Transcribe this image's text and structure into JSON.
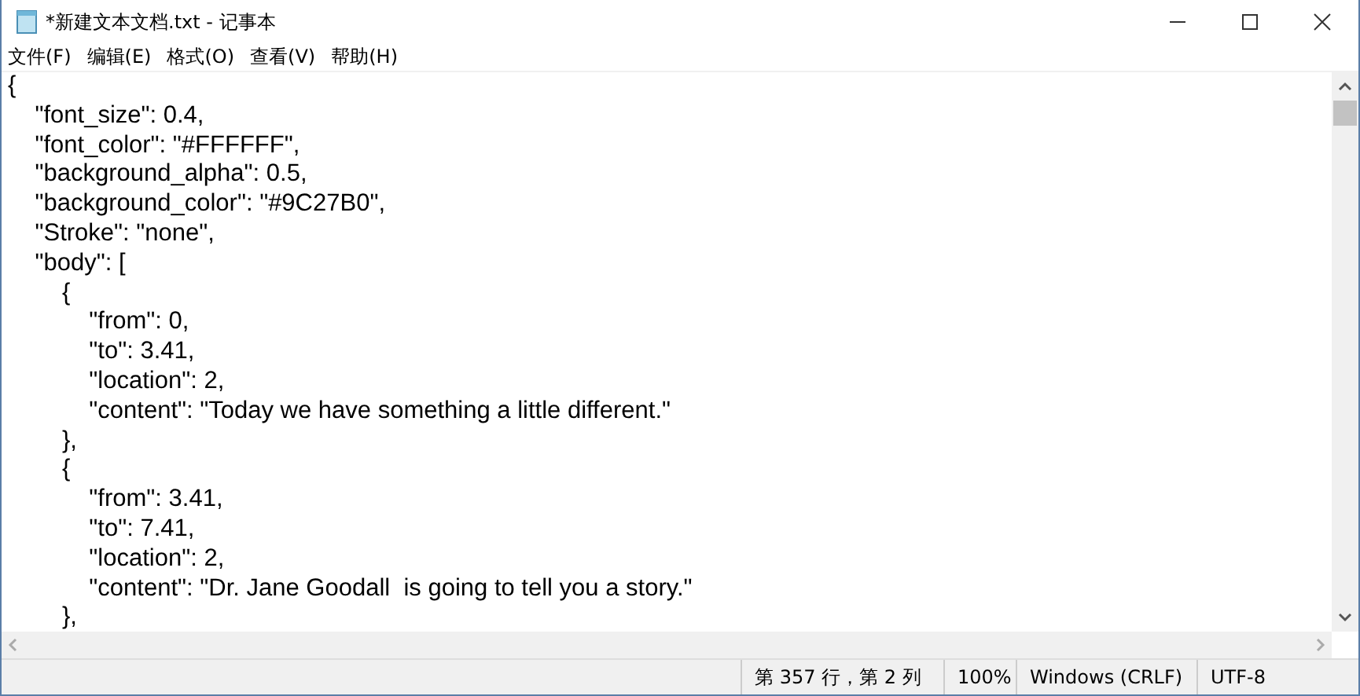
{
  "window": {
    "title": "*新建文本文档.txt - 记事本"
  },
  "menu": [
    "文件(F)",
    "编辑(E)",
    "格式(O)",
    "查看(V)",
    "帮助(H)"
  ],
  "editor": {
    "lines": [
      "{",
      "    \"font_size\": 0.4,",
      "    \"font_color\": \"#FFFFFF\",",
      "    \"background_alpha\": 0.5,",
      "    \"background_color\": \"#9C27B0\",",
      "    \"Stroke\": \"none\",",
      "    \"body\": [",
      "        {",
      "            \"from\": 0,",
      "            \"to\": 3.41,",
      "            \"location\": 2,",
      "            \"content\": \"Today we have something a little different.\"",
      "        },",
      "        {",
      "            \"from\": 3.41,",
      "            \"to\": 7.41,",
      "            \"location\": 2,",
      "            \"content\": \"Dr. Jane Goodall  is going to tell you a story.\"",
      "        },"
    ]
  },
  "status_bar": [
    "第 357 行，第 2 列",
    "100%",
    "Windows (CRLF)",
    "UTF-8"
  ]
}
